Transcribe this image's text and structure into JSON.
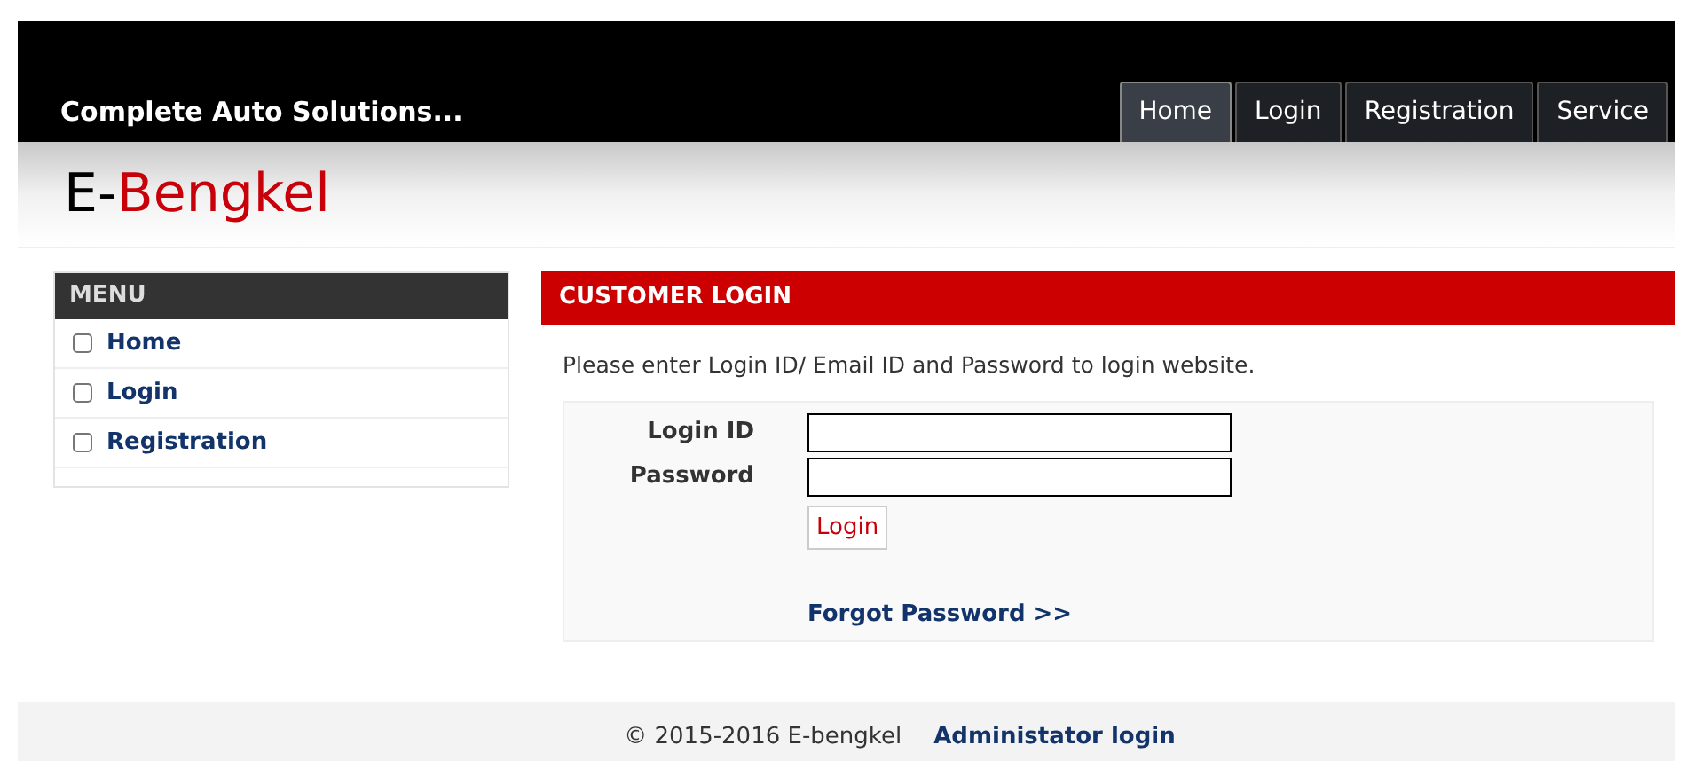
{
  "header": {
    "tagline": "Complete Auto Solutions...",
    "tabs": [
      {
        "label": "Home",
        "selected": true
      },
      {
        "label": "Login",
        "selected": false
      },
      {
        "label": "Registration",
        "selected": false
      },
      {
        "label": "Service",
        "selected": false
      }
    ]
  },
  "logo": {
    "prefix": "E-",
    "name": "Bengkel"
  },
  "sidebar": {
    "title": "MENU",
    "items": [
      {
        "label": "Home",
        "checked": false
      },
      {
        "label": "Login",
        "checked": false
      },
      {
        "label": "Registration",
        "checked": false
      }
    ]
  },
  "login": {
    "title": "CUSTOMER LOGIN",
    "intro": "Please enter Login ID/ Email ID and Password to login website.",
    "fields": [
      {
        "label": "Login ID"
      },
      {
        "label": "Password"
      }
    ],
    "button": "Login",
    "forgot": "Forgot Password >>"
  },
  "footer": {
    "copyright": "© 2015-2016 E-bengkel",
    "admin_link": "Administator login"
  }
}
